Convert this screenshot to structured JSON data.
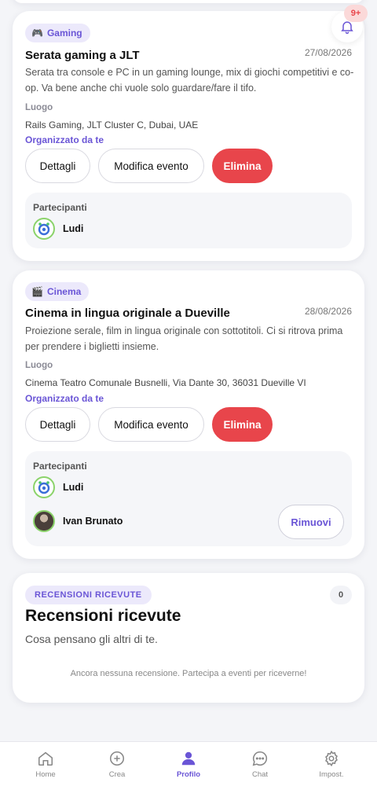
{
  "notifications": {
    "badge": "9+"
  },
  "events": [
    {
      "tag": "Gaming",
      "tag_icon": "gamepad-icon",
      "title": "Serata gaming a JLT",
      "date": "27/08/2026",
      "description": "Serata tra console e PC in un gaming lounge, mix di giochi competitivi e co-op. Va bene anche chi vuole solo guardare/fare il tifo.",
      "location_label": "Luogo",
      "location": "Rails Gaming, JLT Cluster C, Dubai, UAE",
      "organizer": "Organizzato da te",
      "buttons": {
        "details": "Dettagli",
        "edit": "Modifica evento",
        "delete": "Elimina"
      },
      "participants_label": "Partecipanti",
      "participants": [
        {
          "name": "Ludi"
        }
      ]
    },
    {
      "tag": "Cinema",
      "tag_icon": "clapperboard-icon",
      "title": "Cinema in lingua originale a Dueville",
      "date": "28/08/2026",
      "description": "Proiezione serale, film in lingua originale con sottotitoli. Ci si ritrova prima per prendere i biglietti insieme.",
      "location_label": "Luogo",
      "location": "Cinema Teatro Comunale Busnelli, Via Dante 30, 36031 Dueville VI",
      "organizer": "Organizzato da te",
      "buttons": {
        "details": "Dettagli",
        "edit": "Modifica evento",
        "delete": "Elimina"
      },
      "participants_label": "Partecipanti",
      "participants": [
        {
          "name": "Ludi"
        },
        {
          "name": "Ivan Brunato",
          "action": "Rimuovi"
        }
      ]
    }
  ],
  "reviews": {
    "tag": "RECENSIONI RICEVUTE",
    "count": "0",
    "title": "Recensioni ricevute",
    "subtitle": "Cosa pensano gli altri di te.",
    "empty": "Ancora nessuna recensione. Partecipa a eventi per riceverne!"
  },
  "tabbar": {
    "active": "Profilo",
    "tabs": [
      {
        "label": "Home",
        "icon": "home-icon"
      },
      {
        "label": "Crea",
        "icon": "plus-circle-icon"
      },
      {
        "label": "Profilo",
        "icon": "user-icon"
      },
      {
        "label": "Chat",
        "icon": "chat-icon"
      },
      {
        "label": "Impost.",
        "icon": "gear-icon"
      }
    ]
  },
  "colors": {
    "accent": "#6a55d6",
    "danger": "#e8454b",
    "tag_bg": "#ece9fb"
  }
}
